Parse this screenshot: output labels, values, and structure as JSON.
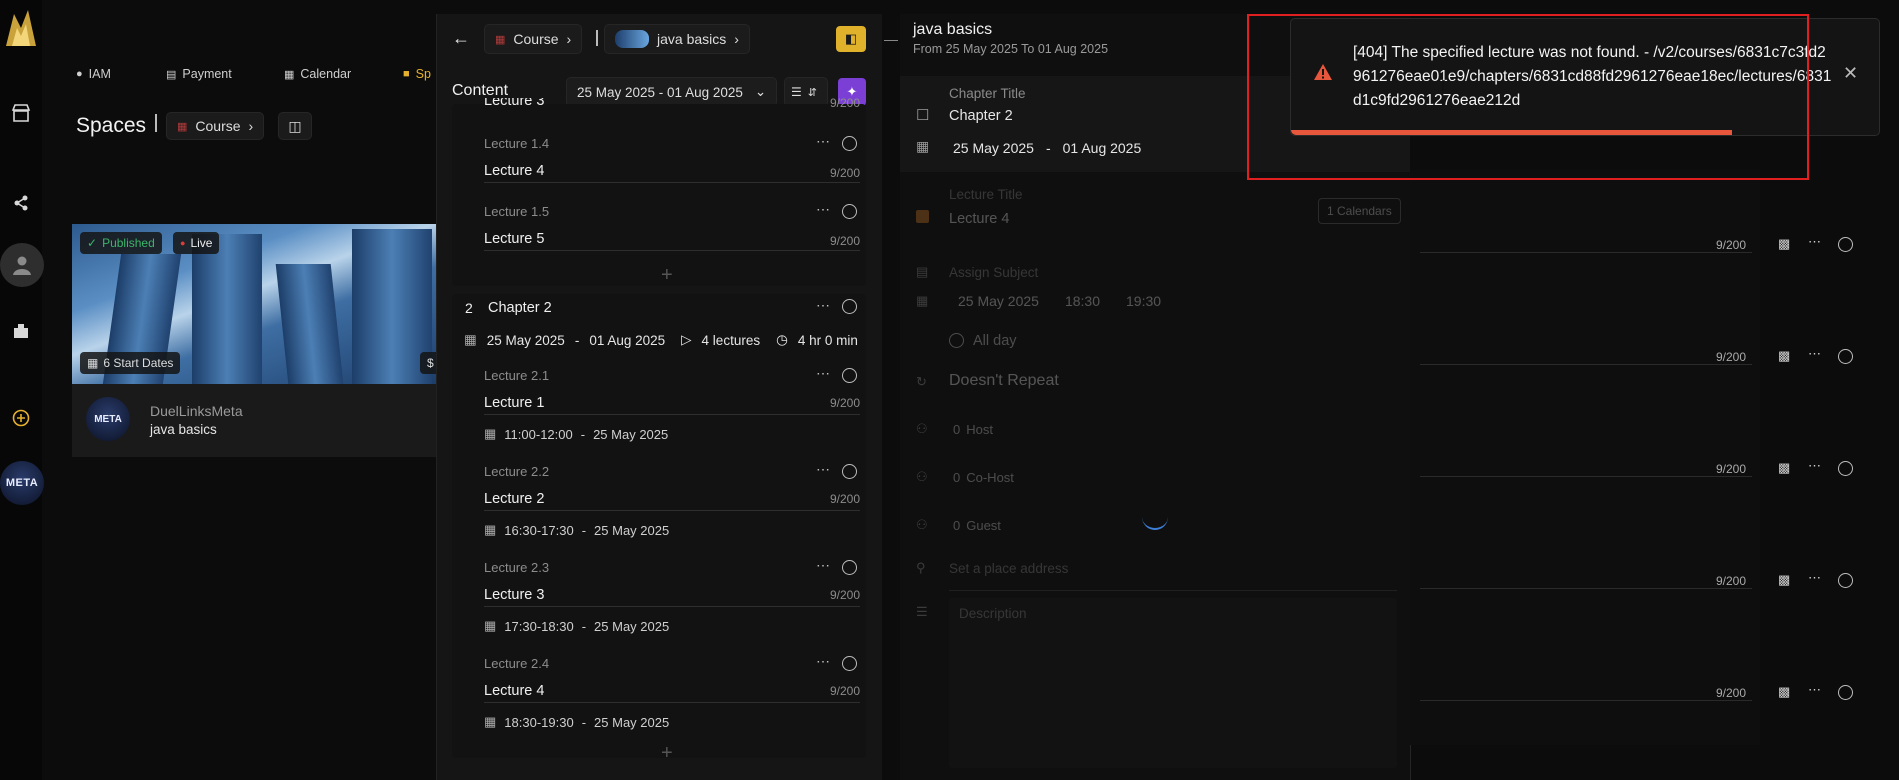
{
  "rail": {
    "items": [
      "store-icon",
      "share-icon",
      "user-avatar",
      "library-icon",
      "add-circle-icon"
    ],
    "meta_logo_text": "META"
  },
  "topnav": [
    {
      "label": "IAM",
      "icon": "user-icon"
    },
    {
      "label": "Payment",
      "icon": "card-icon"
    },
    {
      "label": "Calendar",
      "icon": "calendar-icon"
    },
    {
      "label": "Sp",
      "icon": "spaces-icon"
    }
  ],
  "spaces": {
    "title": "Spaces",
    "breadcrumb": "Course",
    "card": {
      "published": "Published",
      "live": "Live",
      "start_dates": "6 Start Dates",
      "price_prefix": "$",
      "author": "DuelLinksMeta",
      "course_name": "java basics"
    }
  },
  "mid": {
    "breadcrumb_course": "Course",
    "breadcrumb_item": "java basics",
    "content_label": "Content",
    "date_range": "25 May 2025 - 01 Aug 2025",
    "partial_lecture": {
      "title": "Lecture 3",
      "count": "9/200"
    },
    "chapter1_lectures": [
      {
        "num": "Lecture 1.4",
        "title": "Lecture 4",
        "count": "9/200"
      },
      {
        "num": "Lecture 1.5",
        "title": "Lecture 5",
        "count": "9/200"
      }
    ],
    "chapter2": {
      "number": "2",
      "title": "Chapter 2",
      "start": "25 May 2025",
      "end": "01 Aug 2025",
      "lectures_count": "4 lectures",
      "duration": "4 hr 0 min",
      "lectures": [
        {
          "num": "Lecture 2.1",
          "title": "Lecture 1",
          "count": "9/200",
          "time": "11:00-12:00",
          "date": "25 May 2025"
        },
        {
          "num": "Lecture 2.2",
          "title": "Lecture 2",
          "count": "9/200",
          "time": "16:30-17:30",
          "date": "25 May 2025"
        },
        {
          "num": "Lecture 2.3",
          "title": "Lecture 3",
          "count": "9/200",
          "time": "17:30-18:30",
          "date": "25 May 2025"
        },
        {
          "num": "Lecture 2.4",
          "title": "Lecture 4",
          "count": "9/200",
          "time": "18:30-19:30",
          "date": "25 May 2025"
        }
      ]
    }
  },
  "detail": {
    "title": "java basics",
    "subtitle": "From 25 May 2025 To 01 Aug 2025",
    "chapter_label": "Chapter Title",
    "chapter_value": "Chapter 2",
    "chapter_start": "25 May 2025",
    "chapter_end": "01 Aug 2025",
    "lecture_label": "Lecture Title",
    "lecture_value": "Lecture 4",
    "calendars_badge": "1 Calendars",
    "assign_subject": "Assign Subject",
    "lecture_date": "25 May 2025",
    "lecture_start": "18:30",
    "lecture_end": "19:30",
    "all_day": "All day",
    "repeat": "Doesn't Repeat",
    "host": "Host",
    "cohost": "Co-Host",
    "guest": "Guest",
    "zero": "0",
    "place_placeholder": "Set a place address",
    "description_placeholder": "Description"
  },
  "background_rows": [
    "9/200",
    "9/200",
    "9/200",
    "9/200",
    "9/200"
  ],
  "toast": {
    "message": "[404] The specified lecture was not found. - /v2/courses/6831c7c3fd2961276eae01e9/chapters/6831cd88fd2961276eae18ec/lectures/6831d1c9fd2961276eae212d",
    "progress": 0.75,
    "accent": "#e8563b"
  }
}
